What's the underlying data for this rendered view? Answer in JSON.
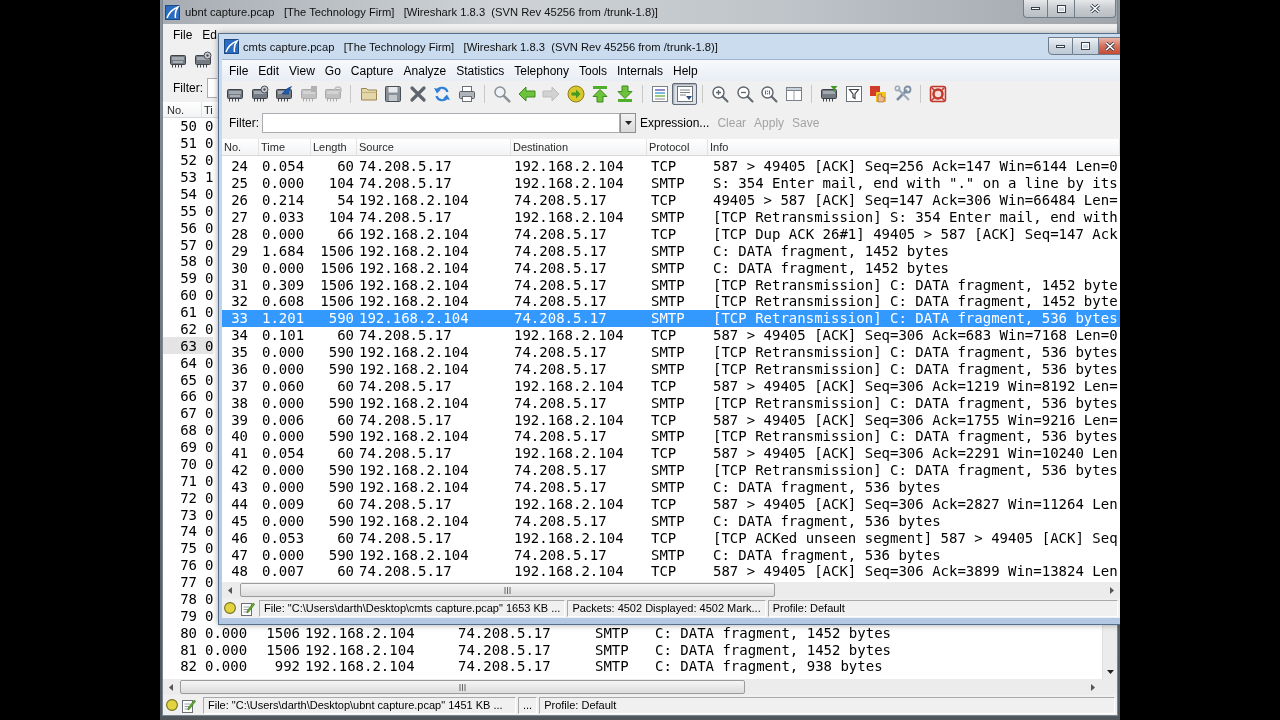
{
  "back_window": {
    "title": "ubnt capture.pcap   [The Technology Firm]   [Wireshark 1.8.3  (SVN Rev 45256 from /trunk-1.8)]",
    "menu": [
      "File",
      "Ed"
    ],
    "filter": {
      "label": "Filter:"
    },
    "columns": [
      "No.",
      "Ti"
    ],
    "packets": [
      {
        "no": "50",
        "time": "0",
        "selected": false
      },
      {
        "no": "51",
        "time": "0",
        "selected": false
      },
      {
        "no": "52",
        "time": "0",
        "selected": false
      },
      {
        "no": "53",
        "time": "1",
        "selected": false
      },
      {
        "no": "54",
        "time": "0",
        "selected": false
      },
      {
        "no": "55",
        "time": "0",
        "selected": false
      },
      {
        "no": "56",
        "time": "0",
        "selected": false
      },
      {
        "no": "57",
        "time": "0",
        "selected": false
      },
      {
        "no": "58",
        "time": "0",
        "selected": false
      },
      {
        "no": "59",
        "time": "0",
        "selected": false
      },
      {
        "no": "60",
        "time": "0",
        "selected": false
      },
      {
        "no": "61",
        "time": "0",
        "selected": false
      },
      {
        "no": "62",
        "time": "0",
        "selected": false
      },
      {
        "no": "63",
        "time": "0",
        "selected": true
      },
      {
        "no": "64",
        "time": "0",
        "selected": false
      },
      {
        "no": "65",
        "time": "0",
        "selected": false
      },
      {
        "no": "66",
        "time": "0",
        "selected": false
      },
      {
        "no": "67",
        "time": "0",
        "selected": false
      },
      {
        "no": "68",
        "time": "0",
        "selected": false
      },
      {
        "no": "69",
        "time": "0",
        "selected": false
      },
      {
        "no": "70",
        "time": "0",
        "selected": false
      },
      {
        "no": "71",
        "time": "0",
        "selected": false
      },
      {
        "no": "72",
        "time": "0",
        "selected": false
      },
      {
        "no": "73",
        "time": "0",
        "selected": false
      },
      {
        "no": "74",
        "time": "0",
        "selected": false
      },
      {
        "no": "75",
        "time": "0",
        "selected": false
      },
      {
        "no": "76",
        "time": "0",
        "selected": false
      },
      {
        "no": "77",
        "time": "0",
        "selected": false
      },
      {
        "no": "78",
        "time": "0",
        "selected": false
      },
      {
        "no": "79",
        "time": "0",
        "selected": false
      },
      {
        "no": "80",
        "time": "0.000",
        "length": "1506",
        "source": "192.168.2.104",
        "destination": "74.208.5.17",
        "protocol": "SMTP",
        "info": "C: DATA fragment, 1452 bytes",
        "selected": false
      },
      {
        "no": "81",
        "time": "0.000",
        "length": "1506",
        "source": "192.168.2.104",
        "destination": "74.208.5.17",
        "protocol": "SMTP",
        "info": "C: DATA fragment, 1452 bytes",
        "selected": false
      },
      {
        "no": "82",
        "time": "0.000",
        "length": "992",
        "source": "192.168.2.104",
        "destination": "74.208.5.17",
        "protocol": "SMTP",
        "info": "C: DATA fragment, 938 bytes",
        "selected": false
      }
    ],
    "status_bar": [
      "File: \"C:\\Users\\darth\\Desktop\\ubnt capture.pcap\" 1451 KB ...",
      "...",
      "Profile: Default"
    ]
  },
  "front_window": {
    "title": "cmts capture.pcap   [The Technology Firm]   [Wireshark 1.8.3  (SVN Rev 45256 from /trunk-1.8)]",
    "menu": [
      "File",
      "Edit",
      "View",
      "Go",
      "Capture",
      "Analyze",
      "Statistics",
      "Telephony",
      "Tools",
      "Internals",
      "Help"
    ],
    "toolbar": [
      {
        "buttons": [
          {
            "pressed": false,
            "disabled": false
          },
          {
            "pressed": false,
            "disabled": false
          },
          {
            "pressed": false,
            "disabled": false
          },
          {
            "pressed": false,
            "disabled": true
          },
          {
            "pressed": false,
            "disabled": true
          }
        ]
      },
      {
        "buttons": [
          {
            "pressed": false,
            "disabled": false
          },
          {
            "pressed": false,
            "disabled": false
          },
          {
            "pressed": false,
            "disabled": false
          },
          {
            "pressed": false,
            "disabled": false
          },
          {
            "pressed": false,
            "disabled": false
          }
        ]
      },
      {
        "buttons": [
          {
            "pressed": false,
            "disabled": false
          },
          {
            "pressed": false,
            "disabled": false
          },
          {
            "pressed": false,
            "disabled": true
          },
          {
            "pressed": false,
            "disabled": false
          },
          {
            "pressed": false,
            "disabled": false
          },
          {
            "pressed": false,
            "disabled": false
          }
        ]
      },
      {
        "buttons": [
          {
            "pressed": false,
            "disabled": false
          },
          {
            "pressed": true,
            "disabled": false
          }
        ]
      },
      {
        "buttons": [
          {
            "pressed": false,
            "disabled": false
          },
          {
            "pressed": false,
            "disabled": false
          },
          {
            "pressed": false,
            "disabled": false
          },
          {
            "pressed": false,
            "disabled": false
          }
        ]
      },
      {
        "buttons": [
          {
            "pressed": false,
            "disabled": false
          },
          {
            "pressed": false,
            "disabled": false
          },
          {
            "pressed": false,
            "disabled": false
          },
          {
            "pressed": false,
            "disabled": false
          }
        ]
      },
      {
        "buttons": [
          {
            "pressed": false,
            "disabled": false
          }
        ]
      }
    ],
    "filter": {
      "label": "Filter:",
      "buttons": [
        {
          "label": "Expression...",
          "disabled": false
        },
        {
          "label": "Clear",
          "disabled": true
        },
        {
          "label": "Apply",
          "disabled": true
        },
        {
          "label": "Save",
          "disabled": true
        }
      ]
    },
    "columns": [
      "No.",
      "Time",
      "Length",
      "Source",
      "Destination",
      "Protocol",
      "Info"
    ],
    "packets": [
      {
        "no": "24",
        "time": "0.054",
        "length": "60",
        "source": "74.208.5.17",
        "destination": "192.168.2.104",
        "protocol": "TCP",
        "info": "587 > 49405 [ACK] Seq=256 Ack=147 Win=6144 Len=0",
        "selected": false
      },
      {
        "no": "25",
        "time": "0.000",
        "length": "104",
        "source": "74.208.5.17",
        "destination": "192.168.2.104",
        "protocol": "SMTP",
        "info": "S: 354 Enter mail, end with \".\" on a line by its",
        "selected": false
      },
      {
        "no": "26",
        "time": "0.214",
        "length": "54",
        "source": "192.168.2.104",
        "destination": "74.208.5.17",
        "protocol": "TCP",
        "info": "49405 > 587 [ACK] Seq=147 Ack=306 Win=66484 Len=",
        "selected": false
      },
      {
        "no": "27",
        "time": "0.033",
        "length": "104",
        "source": "74.208.5.17",
        "destination": "192.168.2.104",
        "protocol": "SMTP",
        "info": "[TCP Retransmission] S: 354 Enter mail, end with",
        "selected": false
      },
      {
        "no": "28",
        "time": "0.000",
        "length": "66",
        "source": "192.168.2.104",
        "destination": "74.208.5.17",
        "protocol": "TCP",
        "info": "[TCP Dup ACK 26#1] 49405 > 587 [ACK] Seq=147 Ack",
        "selected": false
      },
      {
        "no": "29",
        "time": "1.684",
        "length": "1506",
        "source": "192.168.2.104",
        "destination": "74.208.5.17",
        "protocol": "SMTP",
        "info": "C: DATA fragment, 1452 bytes",
        "selected": false
      },
      {
        "no": "30",
        "time": "0.000",
        "length": "1506",
        "source": "192.168.2.104",
        "destination": "74.208.5.17",
        "protocol": "SMTP",
        "info": "C: DATA fragment, 1452 bytes",
        "selected": false
      },
      {
        "no": "31",
        "time": "0.309",
        "length": "1506",
        "source": "192.168.2.104",
        "destination": "74.208.5.17",
        "protocol": "SMTP",
        "info": "[TCP Retransmission] C: DATA fragment, 1452 byte",
        "selected": false
      },
      {
        "no": "32",
        "time": "0.608",
        "length": "1506",
        "source": "192.168.2.104",
        "destination": "74.208.5.17",
        "protocol": "SMTP",
        "info": "[TCP Retransmission] C: DATA fragment, 1452 byte",
        "selected": false
      },
      {
        "no": "33",
        "time": "1.201",
        "length": "590",
        "source": "192.168.2.104",
        "destination": "74.208.5.17",
        "protocol": "SMTP",
        "info": "[TCP Retransmission] C: DATA fragment, 536 bytes",
        "selected": true
      },
      {
        "no": "34",
        "time": "0.101",
        "length": "60",
        "source": "74.208.5.17",
        "destination": "192.168.2.104",
        "protocol": "TCP",
        "info": "587 > 49405 [ACK] Seq=306 Ack=683 Win=7168 Len=0",
        "selected": false
      },
      {
        "no": "35",
        "time": "0.000",
        "length": "590",
        "source": "192.168.2.104",
        "destination": "74.208.5.17",
        "protocol": "SMTP",
        "info": "[TCP Retransmission] C: DATA fragment, 536 bytes",
        "selected": false
      },
      {
        "no": "36",
        "time": "0.000",
        "length": "590",
        "source": "192.168.2.104",
        "destination": "74.208.5.17",
        "protocol": "SMTP",
        "info": "[TCP Retransmission] C: DATA fragment, 536 bytes",
        "selected": false
      },
      {
        "no": "37",
        "time": "0.060",
        "length": "60",
        "source": "74.208.5.17",
        "destination": "192.168.2.104",
        "protocol": "TCP",
        "info": "587 > 49405 [ACK] Seq=306 Ack=1219 Win=8192 Len=",
        "selected": false
      },
      {
        "no": "38",
        "time": "0.000",
        "length": "590",
        "source": "192.168.2.104",
        "destination": "74.208.5.17",
        "protocol": "SMTP",
        "info": "[TCP Retransmission] C: DATA fragment, 536 bytes",
        "selected": false
      },
      {
        "no": "39",
        "time": "0.006",
        "length": "60",
        "source": "74.208.5.17",
        "destination": "192.168.2.104",
        "protocol": "TCP",
        "info": "587 > 49405 [ACK] Seq=306 Ack=1755 Win=9216 Len=",
        "selected": false
      },
      {
        "no": "40",
        "time": "0.000",
        "length": "590",
        "source": "192.168.2.104",
        "destination": "74.208.5.17",
        "protocol": "SMTP",
        "info": "[TCP Retransmission] C: DATA fragment, 536 bytes",
        "selected": false
      },
      {
        "no": "41",
        "time": "0.054",
        "length": "60",
        "source": "74.208.5.17",
        "destination": "192.168.2.104",
        "protocol": "TCP",
        "info": "587 > 49405 [ACK] Seq=306 Ack=2291 Win=10240 Len",
        "selected": false
      },
      {
        "no": "42",
        "time": "0.000",
        "length": "590",
        "source": "192.168.2.104",
        "destination": "74.208.5.17",
        "protocol": "SMTP",
        "info": "[TCP Retransmission] C: DATA fragment, 536 bytes",
        "selected": false
      },
      {
        "no": "43",
        "time": "0.000",
        "length": "590",
        "source": "192.168.2.104",
        "destination": "74.208.5.17",
        "protocol": "SMTP",
        "info": "C: DATA fragment, 536 bytes",
        "selected": false
      },
      {
        "no": "44",
        "time": "0.009",
        "length": "60",
        "source": "74.208.5.17",
        "destination": "192.168.2.104",
        "protocol": "TCP",
        "info": "587 > 49405 [ACK] Seq=306 Ack=2827 Win=11264 Len",
        "selected": false
      },
      {
        "no": "45",
        "time": "0.000",
        "length": "590",
        "source": "192.168.2.104",
        "destination": "74.208.5.17",
        "protocol": "SMTP",
        "info": "C: DATA fragment, 536 bytes",
        "selected": false
      },
      {
        "no": "46",
        "time": "0.053",
        "length": "60",
        "source": "74.208.5.17",
        "destination": "192.168.2.104",
        "protocol": "TCP",
        "info": "[TCP ACKed unseen segment] 587 > 49405 [ACK] Seq",
        "selected": false
      },
      {
        "no": "47",
        "time": "0.000",
        "length": "590",
        "source": "192.168.2.104",
        "destination": "74.208.5.17",
        "protocol": "SMTP",
        "info": "C: DATA fragment, 536 bytes",
        "selected": false
      },
      {
        "no": "48",
        "time": "0.007",
        "length": "60",
        "source": "74.208.5.17",
        "destination": "192.168.2.104",
        "protocol": "TCP",
        "info": "587 > 49405 [ACK] Seq=306 Ack=3899 Win=13824 Len",
        "selected": false
      }
    ],
    "status_bar": [
      "File: \"C:\\Users\\darth\\Desktop\\cmts capture.pcap\" 1653 KB ...",
      "Packets: 4502 Displayed: 4502 Mark...",
      "Profile: Default"
    ]
  }
}
